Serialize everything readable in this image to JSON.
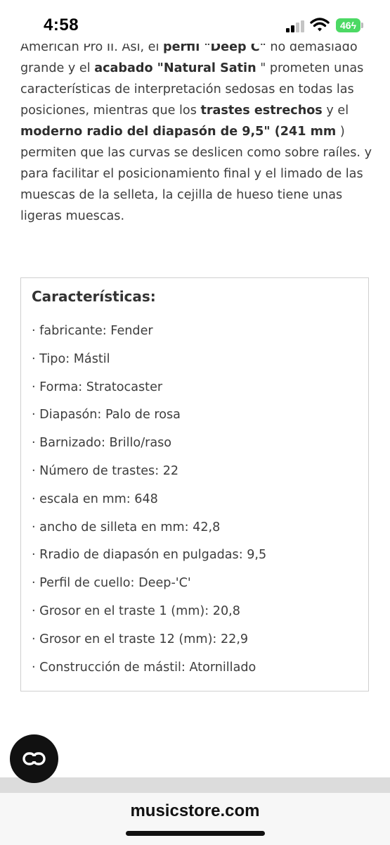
{
  "status_bar": {
    "time": "4:58",
    "battery": "46"
  },
  "article": {
    "line1_pre": "American Pro II. Así, el ",
    "line1_bold1": "perfil \"Deep C\"",
    "line1_post": " no demasiado",
    "text_a": "grande y el ",
    "bold_a": "acabado \"Natural Satin",
    "text_b": " \" prometen unas características de interpretación sedosas en todas las posiciones, mientras que los ",
    "bold_b": "trastes estrechos",
    "text_c": " y el ",
    "bold_c": "moderno radio del diapasón de 9,5\" (241 mm",
    "text_d": " ) permiten que las curvas se deslicen como sobre raíles. y para facilitar el posicionamiento final y el limado de las muescas de la selleta, la cejilla de hueso tiene unas ligeras muescas."
  },
  "features": {
    "title": "Características:",
    "items": [
      "· fabricante: Fender",
      "· Tipo: Mástil",
      "· Forma: Stratocaster",
      "· Diapasón: Palo de rosa",
      "· Barnizado: Brillo/raso",
      "· Número de trastes: 22",
      "· escala en mm: 648",
      "· ancho de silleta en mm: 42,8",
      "· Rradio de diapasón en pulgadas: 9,5",
      "· Perfil de cuello: Deep-'C'",
      "· Grosor en el traste 1 (mm): 20,8",
      "· Grosor en el traste 12 (mm): 22,9",
      "· Construcción de mástil: Atornillado"
    ]
  },
  "fab": {
    "icon": "link-icon"
  },
  "browser": {
    "url": "musicstore.com"
  },
  "colors": {
    "battery": "#4cd964",
    "text": "#3d3d3d",
    "fab": "#111111"
  }
}
